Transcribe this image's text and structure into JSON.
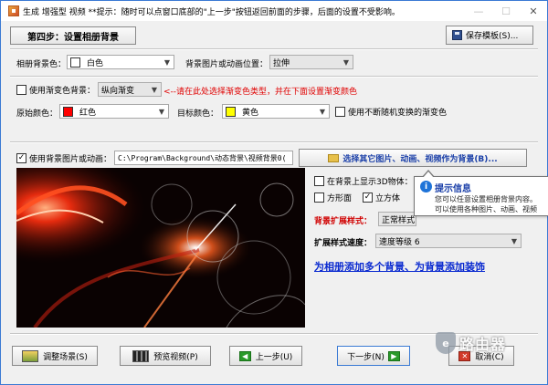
{
  "window": {
    "title": "生成 增强型 视频 **提示：随时可以点窗口底部的\"上一步\"按钮返回前面的步骤，后面的设置不受影响。"
  },
  "header": {
    "step_label": "第四步：设置相册背景",
    "save_template_label": "保存模板(S)..."
  },
  "background": {
    "color_label": "相册背景色：",
    "color_value": "白色",
    "color_swatch": "#ffffff",
    "position_label": "背景图片或动画位置：",
    "position_value": "拉伸"
  },
  "gradient": {
    "use_gradient_label": "使用渐变色背景：",
    "use_gradient_checked": false,
    "gradient_type": "纵向渐变",
    "hint": "<--请在此处选择渐变色类型，并在下面设置渐变颜色",
    "original_color_label": "原始颜色：",
    "original_color_value": "红色",
    "original_color_swatch": "#ff0000",
    "target_color_label": "目标颜色：",
    "target_color_value": "黄色",
    "target_color_swatch": "#ffff00",
    "no_random_label": "使用不断随机变换的渐变色",
    "no_random_checked": false
  },
  "image": {
    "use_image_label": "使用背景图片或动画：",
    "use_image_checked": true,
    "path_value": "C:\\Program\\Background\\动态背景\\视频背景0(",
    "select_button_label": "选择其它图片、动画、视频作为背景(B)..."
  },
  "options": {
    "show_3d_label": "在背景上显示3D物体：",
    "show_3d_checked": false,
    "square_label": "方形面",
    "square_checked": false,
    "cube_label": "立方体",
    "cube_checked": true,
    "expand_style_label": "背景扩展样式：",
    "expand_style_value": "正常样式",
    "expand_speed_label": "扩展样式速度：",
    "expand_speed_value": "速度等级 6",
    "add_backgrounds_link": "为相册添加多个背景、为背景添加装饰"
  },
  "tooltip": {
    "title": "提示信息",
    "line1": "您可以任意设置相册背景内容。",
    "line2": "可以使用各种图片、动画、视频"
  },
  "footer": {
    "adjust_scene_label": "调整场景(S)",
    "preview_video_label": "预览视频(P)",
    "prev_label": "上一步(U)",
    "next_label": "下一步(N)",
    "cancel_label": "取消(C)"
  },
  "watermark": {
    "text": "路由器"
  }
}
